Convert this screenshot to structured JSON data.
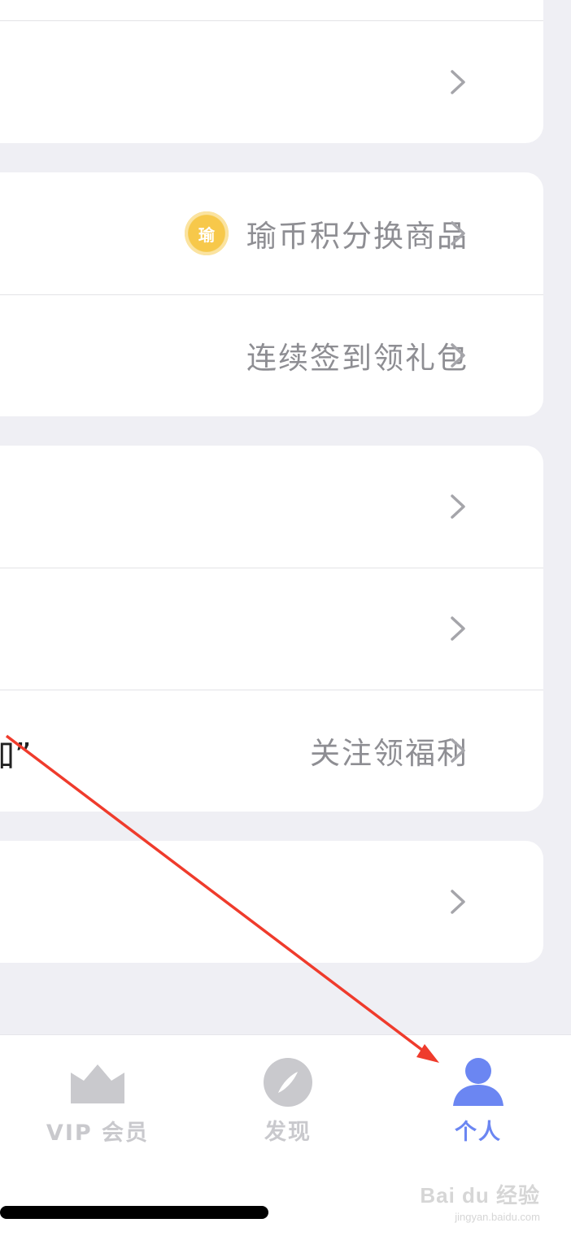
{
  "menu": {
    "points_exchange": {
      "label": "瑜币积分换商品",
      "coin_glyph": "瑜"
    },
    "sign_in": {
      "label": "连续签到领礼包"
    },
    "follow": {
      "partial_text": "加”",
      "label": "关注领福利"
    }
  },
  "tabbar": {
    "tabs": [
      {
        "label": "VIP 会员",
        "icon": "crown-icon",
        "active": false
      },
      {
        "label": "发现",
        "icon": "compass-icon",
        "active": false
      },
      {
        "label": "个人",
        "icon": "person-icon",
        "active": true
      }
    ],
    "active_color": "#6b86f2",
    "inactive_color": "#c9c9cd"
  },
  "annotation": {
    "arrow_color": "#ef3b2c"
  },
  "watermark": {
    "brand": "Bai du 经验",
    "url": "jingyan.baidu.com"
  }
}
